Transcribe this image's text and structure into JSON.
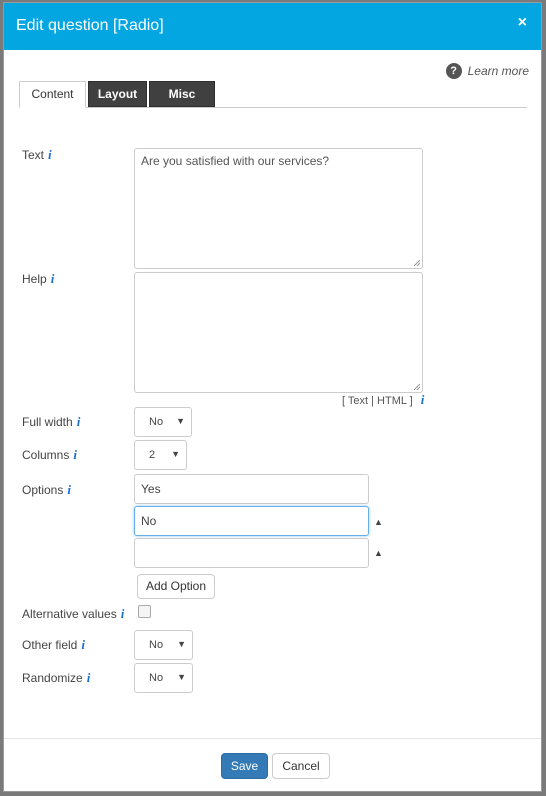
{
  "dialog": {
    "title": "Edit question [Radio]",
    "close_icon": "×",
    "learn_more": "Learn more",
    "help_icon": "?"
  },
  "tabs": [
    {
      "label": "Content",
      "active": true
    },
    {
      "label": "Layout",
      "active": false
    },
    {
      "label": "Misc",
      "active": false
    }
  ],
  "info_glyph": "i",
  "fields": {
    "text": {
      "label": "Text",
      "value": "Are you satisfied with our services?"
    },
    "help": {
      "label": "Help",
      "value": "",
      "format_switch": "[ Text | HTML ]"
    },
    "full_width": {
      "label": "Full width",
      "value": "No"
    },
    "columns": {
      "label": "Columns",
      "value": "2"
    },
    "options": {
      "label": "Options",
      "items": [
        "Yes",
        "No",
        ""
      ],
      "move_up_icon": "▲",
      "add_label": "Add Option"
    },
    "alternative_values": {
      "label": "Alternative values",
      "checked": false
    },
    "other_field": {
      "label": "Other field",
      "value": "No"
    },
    "randomize": {
      "label": "Randomize",
      "value": "No"
    }
  },
  "select_arrow": "▼",
  "footer": {
    "save": "Save",
    "cancel": "Cancel"
  },
  "colors": {
    "header": "#03a6e0",
    "primary_button": "#337ab7",
    "info": "#1a6fd6"
  }
}
